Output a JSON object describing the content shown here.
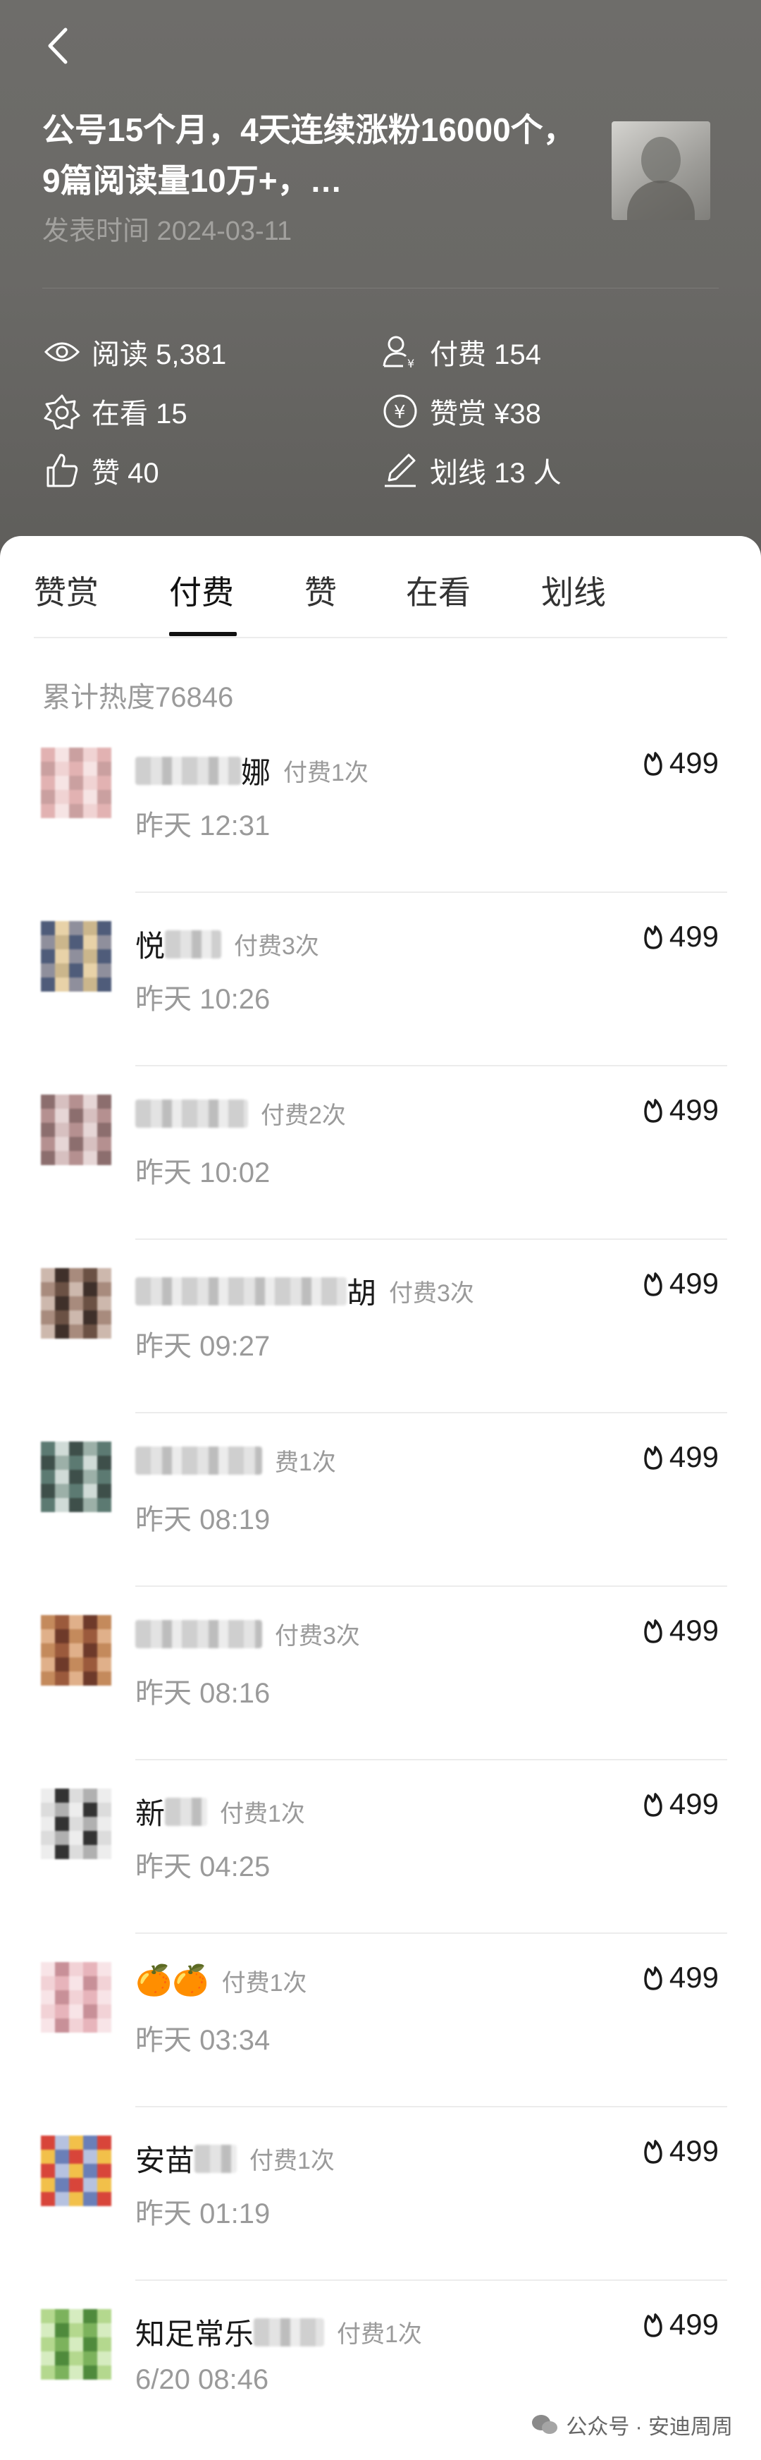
{
  "header": {
    "back_icon": "back-chevron-icon",
    "title": "公号15个月，4天连续涨粉16000个，9篇阅读量10万+，…",
    "publish_time": "发表时间 2024-03-11",
    "stats": {
      "read": "阅读 5,381",
      "paid": "付费 154",
      "watching": "在看 15",
      "reward": "赞赏 ¥38",
      "like": "赞 40",
      "underline": "划线 13 人"
    }
  },
  "tabs": [
    {
      "label": "赞赏",
      "active": false
    },
    {
      "label": "付费",
      "active": true
    },
    {
      "label": "赞",
      "active": false
    },
    {
      "label": "在看",
      "active": false
    },
    {
      "label": "划线",
      "active": false
    }
  ],
  "cumulative_heat": "累计热度76846",
  "rows": [
    {
      "name_visible": "娜",
      "paid": "付费1次",
      "time": "昨天 12:31",
      "heat": "499"
    },
    {
      "name_visible": "悦",
      "paid": "付费3次",
      "time": "昨天 10:26",
      "heat": "499"
    },
    {
      "name_visible": "",
      "paid": "付费2次",
      "time": "昨天 10:02",
      "heat": "499"
    },
    {
      "name_visible": "胡",
      "paid": "付费3次",
      "time": "昨天 09:27",
      "heat": "499"
    },
    {
      "name_visible": "",
      "paid": "费1次",
      "time": "昨天 08:19",
      "heat": "499"
    },
    {
      "name_visible": "",
      "paid": "付费3次",
      "time": "昨天 08:16",
      "heat": "499"
    },
    {
      "name_visible": "新",
      "paid": "付费1次",
      "time": "昨天 04:25",
      "heat": "499"
    },
    {
      "name_visible": "🍊🍊",
      "paid": "付费1次",
      "time": "昨天 03:34",
      "heat": "499"
    },
    {
      "name_visible": "安苗",
      "paid": "付费1次",
      "time": "昨天 01:19",
      "heat": "499"
    },
    {
      "name_visible": "知足常乐",
      "paid": "付费1次",
      "time": "6/20 08:46",
      "heat": "499"
    }
  ],
  "watermark": "公众号 · 安迪周周"
}
